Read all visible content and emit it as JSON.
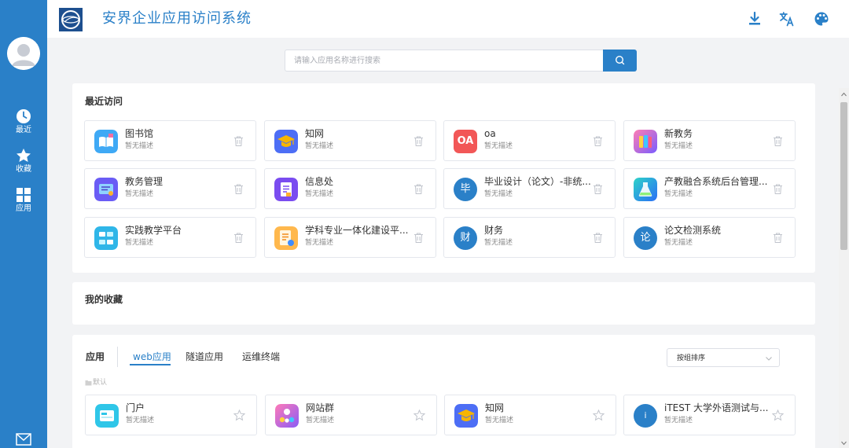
{
  "sidebar": {
    "items": [
      {
        "label": "最近",
        "icon": "clock-icon"
      },
      {
        "label": "收藏",
        "icon": "star-icon"
      },
      {
        "label": "应用",
        "icon": "grid-icon"
      }
    ]
  },
  "header": {
    "title": "安界企业应用访问系统",
    "icons": [
      "download-icon",
      "translate-icon",
      "palette-icon"
    ]
  },
  "search": {
    "placeholder": "请输入应用名称进行搜索"
  },
  "recent": {
    "title": "最近访问",
    "items": [
      {
        "name": "图书馆",
        "desc": "暂无描述"
      },
      {
        "name": "知网",
        "desc": "暂无描述"
      },
      {
        "name": "oa",
        "desc": "暂无描述",
        "icon_text": "OA"
      },
      {
        "name": "新教务",
        "desc": "暂无描述"
      },
      {
        "name": "教务管理",
        "desc": "暂无描述"
      },
      {
        "name": "信息处",
        "desc": "暂无描述"
      },
      {
        "name": "毕业设计（论文）-非统...",
        "desc": "暂无描述",
        "icon_text": "毕"
      },
      {
        "name": "产教融合系统后台管理...",
        "desc": "暂无描述"
      },
      {
        "name": "实践教学平台",
        "desc": "暂无描述"
      },
      {
        "name": "学科专业一体化建设平...",
        "desc": "暂无描述"
      },
      {
        "name": "财务",
        "desc": "暂无描述",
        "icon_text": "财"
      },
      {
        "name": "论文检测系统",
        "desc": "暂无描述",
        "icon_text": "论"
      }
    ]
  },
  "favorites": {
    "title": "我的收藏"
  },
  "apps": {
    "title": "应用",
    "tabs": [
      "web应用",
      "隧道应用",
      "运维终端"
    ],
    "active_tab": "web应用",
    "sort_select": "按组排序",
    "group_label": "默认",
    "items": [
      {
        "name": "门户",
        "desc": "暂无描述"
      },
      {
        "name": "网站群",
        "desc": "暂无描述"
      },
      {
        "name": "知网",
        "desc": "暂无描述"
      },
      {
        "name": "iTEST 大学外语测试与...",
        "desc": "暂无描述",
        "icon_text": "i"
      }
    ]
  },
  "colors": {
    "primary": "#2a80c8",
    "background": "#f2f3f5"
  }
}
